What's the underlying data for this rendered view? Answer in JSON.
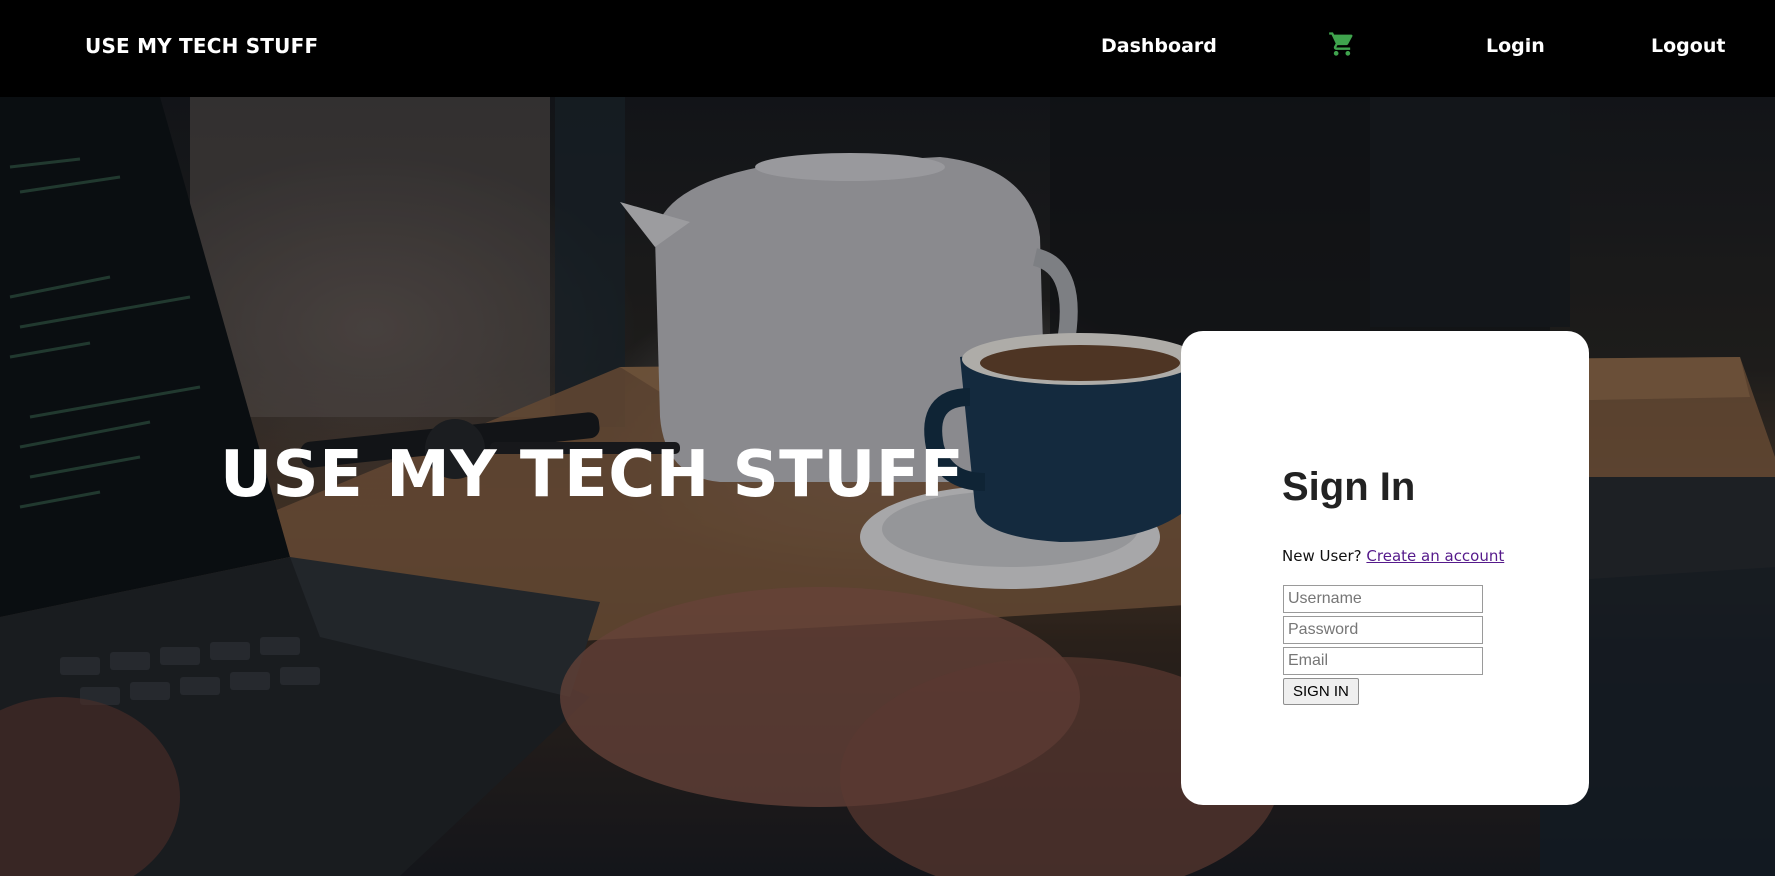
{
  "nav": {
    "brand": "USE MY TECH STUFF",
    "dashboard_label": "Dashboard",
    "cart_icon": "cart-icon",
    "login_label": "Login",
    "logout_label": "Logout"
  },
  "hero": {
    "title": "USE MY TECH STUFF"
  },
  "signin": {
    "title": "Sign In",
    "new_user_text": "New User?",
    "create_account_link": "Create an account",
    "username_placeholder": "Username",
    "password_placeholder": "Password",
    "email_placeholder": "Email",
    "button_label": "SIGN IN"
  },
  "colors": {
    "nav_background": "#000000",
    "cart_icon": "#3fa34d",
    "link_visited": "#551a8b",
    "card_background": "#ffffff"
  }
}
